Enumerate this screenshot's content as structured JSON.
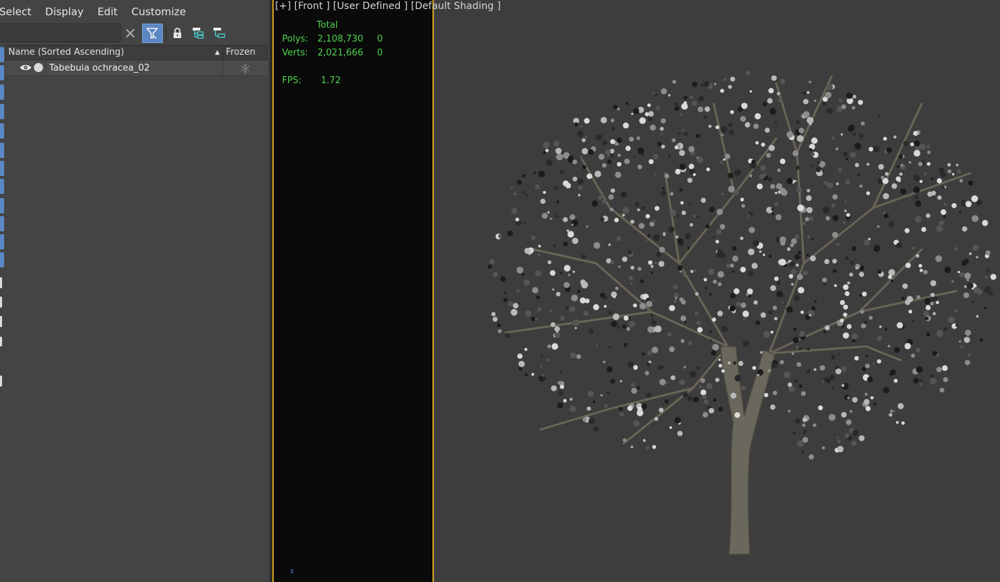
{
  "menu": {
    "items": [
      "Select",
      "Display",
      "Edit",
      "Customize"
    ]
  },
  "toolbar": {
    "search_value": "",
    "icons": [
      "clear-search-icon",
      "filter-icon",
      "lock-icon",
      "hierarchy-icon",
      "hierarchy-alt-icon"
    ]
  },
  "columns": {
    "name_header": "Name (Sorted Ascending)",
    "sort_indicator": "▲",
    "frozen_header": "Frozen"
  },
  "rows": [
    {
      "name": "Tabebuia ochracea_02",
      "visible": true,
      "frozen": false
    }
  ],
  "viewport": {
    "label": "[+] [Front ] [User Defined ] [Default Shading ]",
    "stats": {
      "total_label": "Total",
      "polys_label": "Polys:",
      "polys_total": "2,108,730",
      "polys_selected": "0",
      "verts_label": "Verts:",
      "verts_total": "2,021,666",
      "verts_selected": "0",
      "fps_label": "FPS:",
      "fps_value": "1.72"
    },
    "axis_label": "z"
  },
  "colors": {
    "accent": "#5b88c4",
    "viewport_border": "#d3a21b",
    "stats_text": "#4fd24f"
  }
}
